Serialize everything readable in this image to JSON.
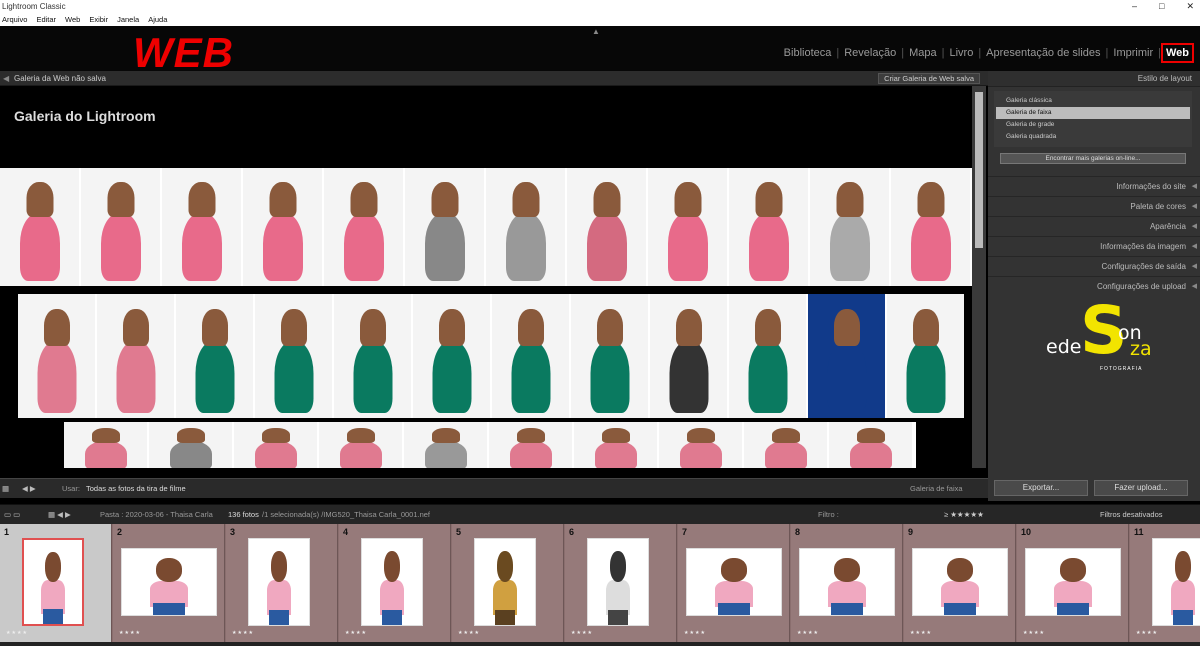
{
  "window": {
    "title": "Lightroom Classic",
    "controls": [
      "–",
      "□",
      "✕"
    ]
  },
  "menu": [
    "Arquivo",
    "Editar",
    "Web",
    "Exibir",
    "Janela",
    "Ajuda"
  ],
  "logo_text": "WEB",
  "modules": [
    "Biblioteca",
    "Revelação",
    "Mapa",
    "Livro",
    "Apresentação de slides",
    "Imprimir",
    "Web"
  ],
  "active_module": "Web",
  "center": {
    "header_title": "Galeria da Web não salva",
    "create_button": "Criar Galeria de Web salva",
    "gallery_title": "Galeria do Lightroom"
  },
  "toolbar": {
    "usar_label": "Usar:",
    "usar_value": "Todas as fotos da tira de filme",
    "right_label": "Galeria de faixa"
  },
  "right_panel": {
    "layout_header": "Estilo de layout",
    "styles": [
      {
        "label": "Galeria clássica",
        "selected": false
      },
      {
        "label": "Galeria de faixa",
        "selected": true
      },
      {
        "label": "Galeria de grade",
        "selected": false
      },
      {
        "label": "Galeria quadrada",
        "selected": false
      }
    ],
    "find_button": "Encontrar mais galerias on-line...",
    "sections": [
      "Informações do site",
      "Paleta de cores",
      "Aparência",
      "Informações da imagem",
      "Configurações de saída",
      "Configurações de upload"
    ],
    "brand": {
      "text_left": "ede",
      "big_letter": "S",
      "text_mid": "on",
      "text_right": "za",
      "sub": "FOTOGRAFIA",
      "accent": "#f2e400"
    },
    "export_button": "Exportar...",
    "upload_button": "Fazer upload..."
  },
  "filmstrip_bar": {
    "path": "Pasta : 2020-03-06 - Thaisa Carla",
    "count": "136 fotos",
    "selection": "/1 selecionada(s) /IMG520_Thaisa Carla_0001.nef",
    "filter_label": "Filtro :",
    "filter_off": "Filtros desativados",
    "rating_prefix": "≥"
  },
  "filmstrip": [
    {
      "n": "1",
      "tone": "color",
      "portrait": true
    },
    {
      "n": "2",
      "tone": "color",
      "portrait": false
    },
    {
      "n": "3",
      "tone": "color",
      "portrait": true
    },
    {
      "n": "4",
      "tone": "color",
      "portrait": true
    },
    {
      "n": "5",
      "tone": "sepia",
      "portrait": true
    },
    {
      "n": "6",
      "tone": "bw",
      "portrait": true
    },
    {
      "n": "7",
      "tone": "color",
      "portrait": false
    },
    {
      "n": "8",
      "tone": "color",
      "portrait": false
    },
    {
      "n": "9",
      "tone": "color",
      "portrait": false
    },
    {
      "n": "10",
      "tone": "color",
      "portrait": false
    },
    {
      "n": "11",
      "tone": "color",
      "portrait": true
    }
  ],
  "strip_rows": [
    {
      "count": 12,
      "colors": [
        "#e86a8a",
        "#e86a8a",
        "#e86a8a",
        "#e86a8a",
        "#e86a8a",
        "#888",
        "#999",
        "#d46a80",
        "#e86a8a",
        "#e86a8a",
        "#aaa",
        "#e86a8a"
      ]
    },
    {
      "count": 12,
      "colors": [
        "#e07a90",
        "#e07a90",
        "#0a7a60",
        "#0a7a60",
        "#0a7a60",
        "#0a7a60",
        "#0a7a60",
        "#0a7a60",
        "#333",
        "#0a7a60",
        "#113a8a",
        "#0a7a60"
      ]
    },
    {
      "count": 10,
      "colors": [
        "#e07a90",
        "#888",
        "#e07a90",
        "#e07a90",
        "#999",
        "#e07a90",
        "#e07a90",
        "#e07a90",
        "#e07a90",
        "#e07a90"
      ]
    }
  ]
}
